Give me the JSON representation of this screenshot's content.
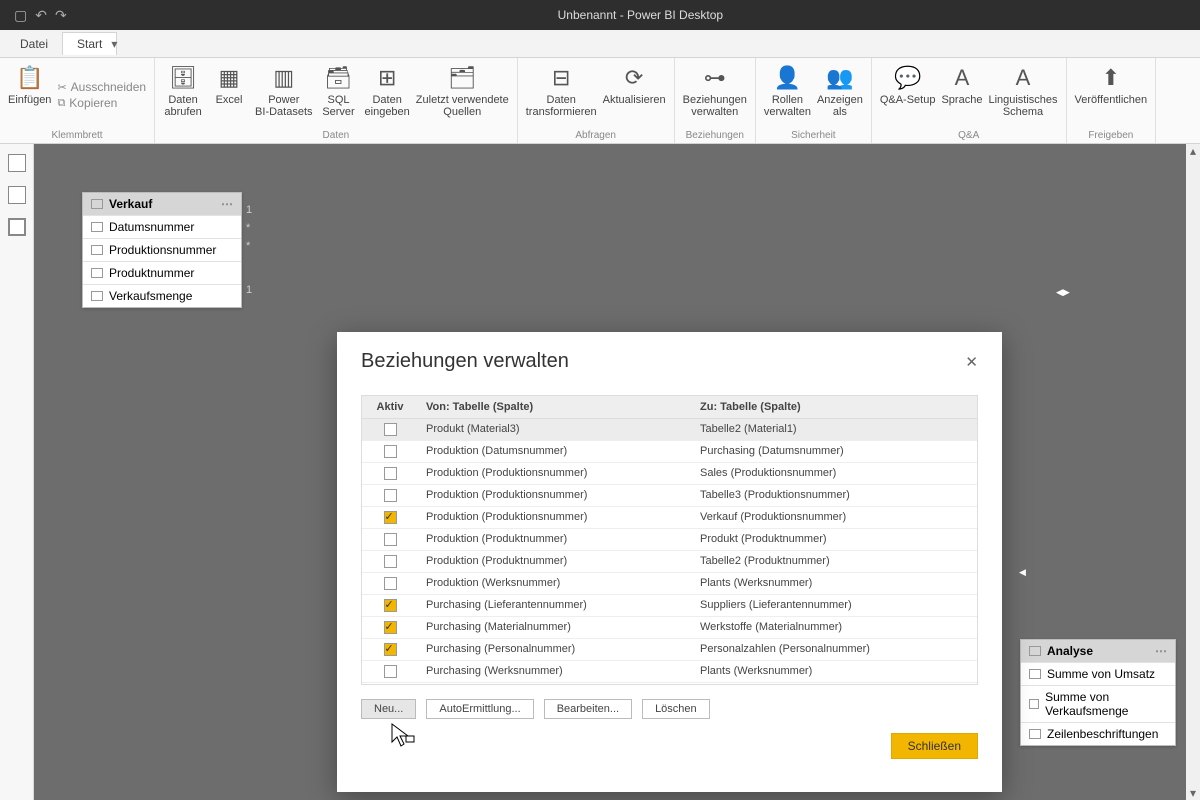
{
  "window_title": "Unbenannt - Power BI Desktop",
  "menubar": {
    "file": "Datei",
    "home": "Start"
  },
  "clipboard": {
    "paste": "Einfügen",
    "cut": "Ausschneiden",
    "copy": "Kopieren",
    "label": "Klemmbrett"
  },
  "data_group": {
    "label": "Daten",
    "get_data": "Daten\nabrufen",
    "excel": "Excel",
    "pbi_ds": "Power\nBI-Datasets",
    "sql": "SQL\nServer",
    "enter": "Daten\neingeben",
    "recent": "Zuletzt verwendete\nQuellen"
  },
  "queries": {
    "label": "Abfragen",
    "transform": "Daten\ntransformieren",
    "refresh": "Aktualisieren"
  },
  "rel": {
    "label": "Beziehungen",
    "manage": "Beziehungen\nverwalten"
  },
  "security": {
    "label": "Sicherheit",
    "roles": "Rollen\nverwalten",
    "viewas": "Anzeigen\nals"
  },
  "qa": {
    "label": "Q&A",
    "setup": "Q&A-Setup",
    "lang": "Sprache",
    "schema": "Linguistisches\nSchema"
  },
  "share": {
    "label": "Freigeben",
    "publish": "Veröffentlichen"
  },
  "verkauf": {
    "title": "Verkauf",
    "fields": [
      "Datumsnummer",
      "Produktionsnummer",
      "Produktnummer",
      "Verkaufsmenge"
    ]
  },
  "analyse": {
    "title": "Analyse",
    "fields": [
      "Summe von Umsatz",
      "Summe von Verkaufsmenge",
      "Zeilenbeschriftungen"
    ]
  },
  "connectors": {
    "one": "1",
    "many": "*"
  },
  "dialog": {
    "title": "Beziehungen verwalten",
    "col_active": "Aktiv",
    "col_from": "Von: Tabelle (Spalte)",
    "col_to": "Zu: Tabelle (Spalte)",
    "rows": [
      {
        "a": false,
        "f": "Produkt (Material3)",
        "t": "Tabelle2 (Material1)",
        "sel": true
      },
      {
        "a": false,
        "f": "Produktion (Datumsnummer)",
        "t": "Purchasing (Datumsnummer)"
      },
      {
        "a": false,
        "f": "Produktion (Produktionsnummer)",
        "t": "Sales (Produktionsnummer)"
      },
      {
        "a": false,
        "f": "Produktion (Produktionsnummer)",
        "t": "Tabelle3 (Produktionsnummer)"
      },
      {
        "a": true,
        "f": "Produktion (Produktionsnummer)",
        "t": "Verkauf (Produktionsnummer)"
      },
      {
        "a": false,
        "f": "Produktion (Produktnummer)",
        "t": "Produkt (Produktnummer)"
      },
      {
        "a": false,
        "f": "Produktion (Produktnummer)",
        "t": "Tabelle2 (Produktnummer)"
      },
      {
        "a": false,
        "f": "Produktion (Werksnummer)",
        "t": "Plants (Werksnummer)"
      },
      {
        "a": true,
        "f": "Purchasing (Lieferantennummer)",
        "t": "Suppliers (Lieferantennummer)"
      },
      {
        "a": true,
        "f": "Purchasing (Materialnummer)",
        "t": "Werkstoffe (Materialnummer)"
      },
      {
        "a": true,
        "f": "Purchasing (Personalnummer)",
        "t": "Personalzahlen (Personalnummer)"
      },
      {
        "a": false,
        "f": "Purchasing (Werksnummer)",
        "t": "Plants (Werksnummer)"
      }
    ],
    "btn_new": "Neu...",
    "btn_auto": "AutoErmittlung...",
    "btn_edit": "Bearbeiten...",
    "btn_del": "Löschen",
    "btn_close": "Schließen"
  }
}
